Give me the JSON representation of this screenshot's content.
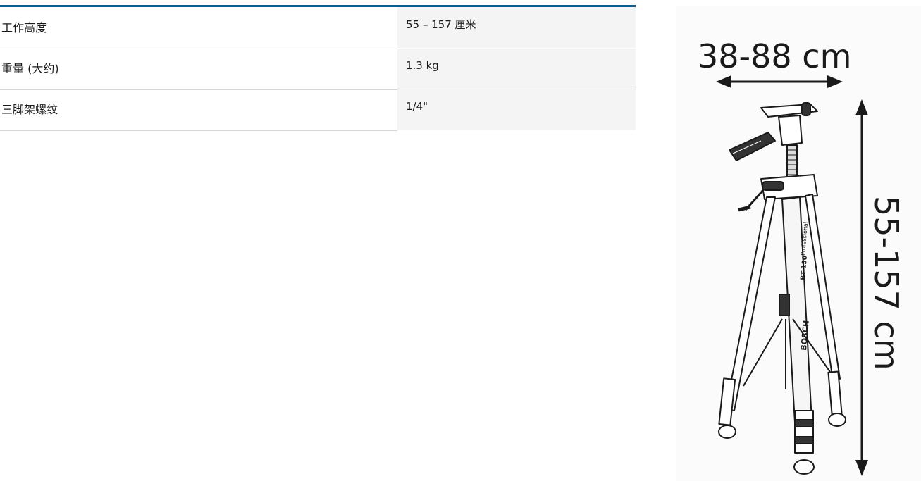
{
  "specs": {
    "rows": [
      {
        "label": "工作高度",
        "value": "55 – 157 厘米"
      },
      {
        "label": "重量 (大约)",
        "value": "1.3 kg"
      },
      {
        "label": "三脚架螺纹",
        "value": "1/4\""
      }
    ]
  },
  "image": {
    "width_dimension": "38-88 cm",
    "height_dimension": "55-157 cm",
    "brand_text": "BOSCH",
    "model_text": "BT 150",
    "series_text": "Professional"
  }
}
